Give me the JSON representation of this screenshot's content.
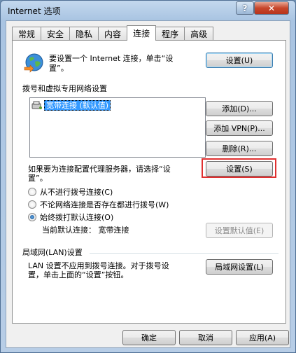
{
  "window": {
    "title": "Internet 选项",
    "help_label": "?",
    "close_label": "✕"
  },
  "tabs": [
    "常规",
    "安全",
    "隐私",
    "内容",
    "连接",
    "程序",
    "高级"
  ],
  "active_tab": 4,
  "setup": {
    "text_line1": "要设置一个 Internet 连接，单击“设",
    "text_line2": "置”。",
    "button": "设置(U)"
  },
  "dialup": {
    "heading": "拨号和虚拟专用网络设置",
    "items": [
      {
        "label": "宽带连接 (默认值)"
      }
    ],
    "add_button": "添加(D)...",
    "add_vpn_button": "添加 VPN(P)...",
    "delete_button": "删除(R)...",
    "proxy_text_line1": "如果要为连接配置代理服务器，请选择“设",
    "proxy_text_line2": "置”。",
    "settings_button": "设置(S)",
    "radios": [
      {
        "label": "从不进行拨号连接(C)",
        "checked": false
      },
      {
        "label": "不论网络连接是否存在都进行拨号(W)",
        "checked": false
      },
      {
        "label": "始终拨打默认连接(O)",
        "checked": true
      }
    ],
    "current_default": "当前默认连接：  宽带连接",
    "set_default_button": "设置默认值(E)"
  },
  "lan": {
    "heading": "局域网(LAN)设置",
    "text_line1": "LAN 设置不应用到拨号连接。对于拨号设",
    "text_line2": "置，单击上面的“设置”按钮。",
    "button": "局域网设置(L)"
  },
  "footer": {
    "ok": "确定",
    "cancel": "取消",
    "apply": "应用(A)"
  }
}
